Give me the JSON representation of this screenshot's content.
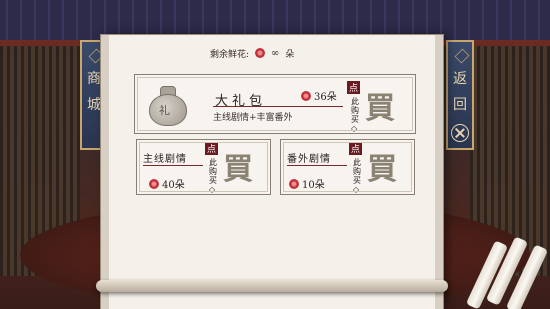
{
  "banner": {
    "shop": [
      "商",
      "城"
    ],
    "back": [
      "返",
      "回"
    ]
  },
  "header": {
    "remaining_label": "剩余鲜花:",
    "remaining_value": "∞",
    "unit": "朵"
  },
  "ui": {
    "dian": "点",
    "buy_hint": "此购买◇",
    "buy": "買"
  },
  "items": [
    {
      "title": "大礼包",
      "bag_mark": "礼",
      "desc": "主线剧情+丰富番外",
      "price": "36朵"
    },
    {
      "title": "主线剧情",
      "price": "40朵"
    },
    {
      "title": "番外剧情",
      "price": "10朵"
    }
  ],
  "colors": {
    "accent": "#6a1a20",
    "scroll_paper": "#f4f0ea",
    "banner_blue": "#3a4a6a",
    "gold_trim": "#c9a66b"
  }
}
